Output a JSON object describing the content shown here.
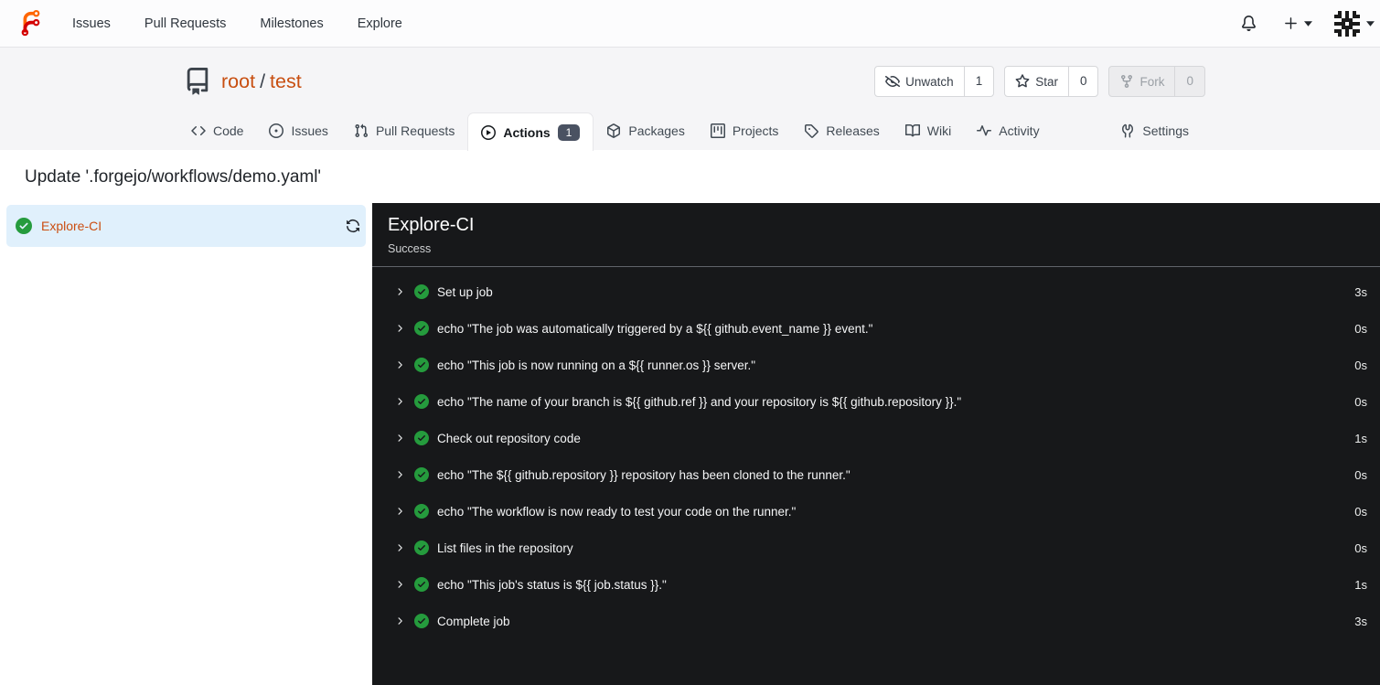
{
  "navbar": {
    "items": [
      {
        "label": "Issues"
      },
      {
        "label": "Pull Requests"
      },
      {
        "label": "Milestones"
      },
      {
        "label": "Explore"
      }
    ]
  },
  "repo": {
    "owner": "root",
    "separator": "/",
    "name": "test",
    "actions": [
      {
        "label": "Unwatch",
        "count": "1"
      },
      {
        "label": "Star",
        "count": "0"
      },
      {
        "label": "Fork",
        "count": "0"
      }
    ]
  },
  "tabs": {
    "items": [
      {
        "label": "Code"
      },
      {
        "label": "Issues"
      },
      {
        "label": "Pull Requests"
      },
      {
        "label": "Actions",
        "badge": "1"
      },
      {
        "label": "Packages"
      },
      {
        "label": "Projects"
      },
      {
        "label": "Releases"
      },
      {
        "label": "Wiki"
      },
      {
        "label": "Activity"
      }
    ],
    "settings_label": "Settings"
  },
  "run": {
    "title": "Update '.forgejo/workflows/demo.yaml'",
    "job": {
      "name": "Explore-CI",
      "status": "Success"
    },
    "steps": [
      {
        "name": "Set up job",
        "duration": "3s"
      },
      {
        "name": "echo \"The job was automatically triggered by a ${{ github.event_name }} event.\"",
        "duration": "0s"
      },
      {
        "name": "echo \"This job is now running on a ${{ runner.os }} server.\"",
        "duration": "0s"
      },
      {
        "name": "echo \"The name of your branch is ${{ github.ref }} and your repository is ${{ github.repository }}.\"",
        "duration": "0s"
      },
      {
        "name": "Check out repository code",
        "duration": "1s"
      },
      {
        "name": "echo \"The ${{ github.repository }} repository has been cloned to the runner.\"",
        "duration": "0s"
      },
      {
        "name": "echo \"The workflow is now ready to test your code on the runner.\"",
        "duration": "0s"
      },
      {
        "name": "List files in the repository",
        "duration": "0s"
      },
      {
        "name": "echo \"This job's status is ${{ job.status }}.\"",
        "duration": "1s"
      },
      {
        "name": "Complete job",
        "duration": "3s"
      }
    ]
  },
  "colors": {
    "accent_link": "#c84f11",
    "success_green": "#259b3d",
    "panel_bg": "#17181a",
    "job_selected_bg": "#e0f0fc"
  }
}
